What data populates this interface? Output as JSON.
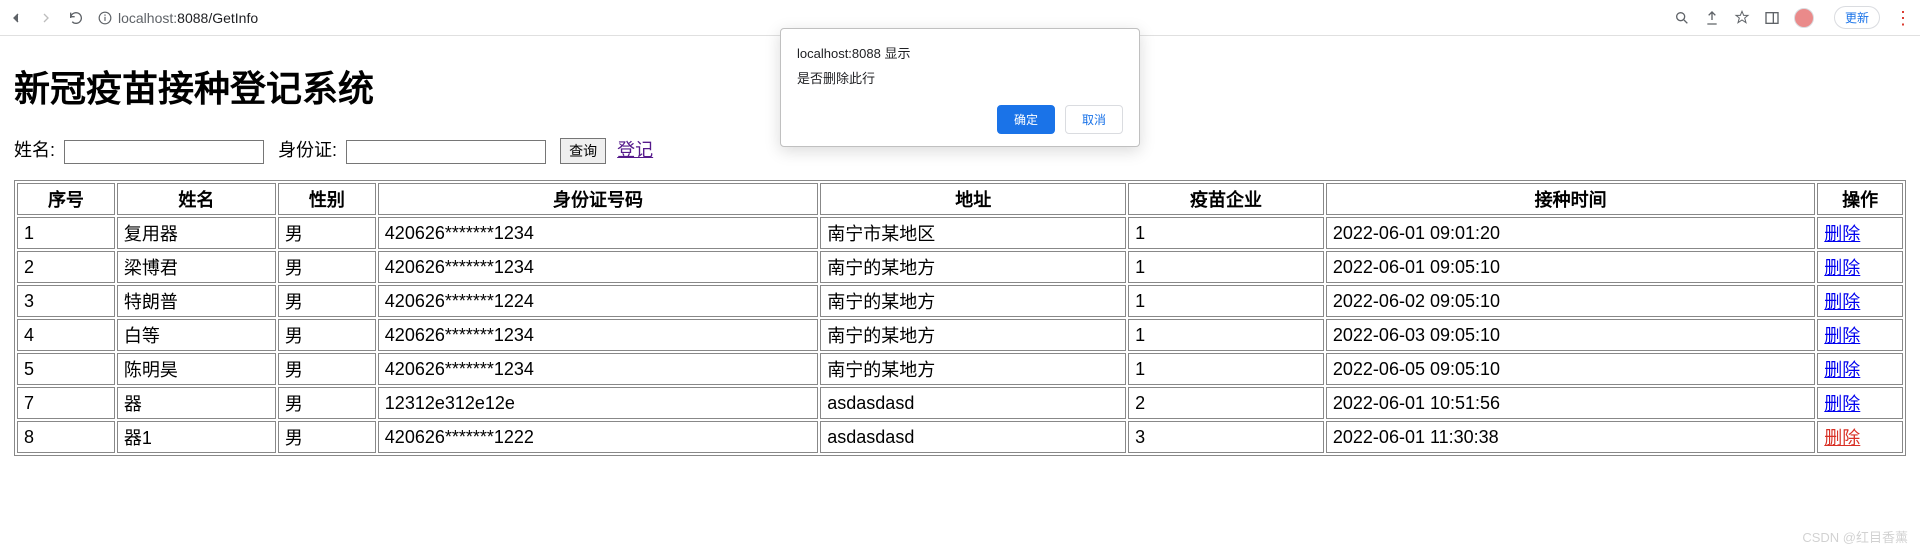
{
  "browser": {
    "url_host": "localhost:",
    "url_port": "8088",
    "url_path": "/GetInfo",
    "update_label": "更新"
  },
  "dialog": {
    "title": "localhost:8088 显示",
    "message": "是否删除此行",
    "ok": "确定",
    "cancel": "取消"
  },
  "page": {
    "title": "新冠疫苗接种登记系统",
    "search": {
      "name_label": "姓名:",
      "id_label": "身份证:",
      "query_btn": "查询",
      "register_link": "登记",
      "name_value": "",
      "id_value": ""
    },
    "columns": {
      "seq": "序号",
      "name": "姓名",
      "gender": "性别",
      "id": "身份证号码",
      "addr": "地址",
      "company": "疫苗企业",
      "time": "接种时间",
      "action": "操作"
    },
    "delete_label": "删除",
    "rows": [
      {
        "seq": "1",
        "name": "复用器",
        "gender": "男",
        "id": "420626*******1234",
        "addr": "南宁市某地区",
        "company": "1",
        "time": "2022-06-01 09:01:20",
        "active": false
      },
      {
        "seq": "2",
        "name": "梁博君",
        "gender": "男",
        "id": "420626*******1234",
        "addr": "南宁的某地方",
        "company": "1",
        "time": "2022-06-01 09:05:10",
        "active": false
      },
      {
        "seq": "3",
        "name": "特朗普",
        "gender": "男",
        "id": "420626*******1224",
        "addr": "南宁的某地方",
        "company": "1",
        "time": "2022-06-02 09:05:10",
        "active": false
      },
      {
        "seq": "4",
        "name": "白等",
        "gender": "男",
        "id": "420626*******1234",
        "addr": "南宁的某地方",
        "company": "1",
        "time": "2022-06-03 09:05:10",
        "active": false
      },
      {
        "seq": "5",
        "name": "陈明昊",
        "gender": "男",
        "id": "420626*******1234",
        "addr": "南宁的某地方",
        "company": "1",
        "time": "2022-06-05 09:05:10",
        "active": false
      },
      {
        "seq": "7",
        "name": "器",
        "gender": "男",
        "id": "12312e312e12e",
        "addr": "asdasdasd",
        "company": "2",
        "time": "2022-06-01 10:51:56",
        "active": false
      },
      {
        "seq": "8",
        "name": "器1",
        "gender": "男",
        "id": "420626*******1222",
        "addr": "asdasdasd",
        "company": "3",
        "time": "2022-06-01 11:30:38",
        "active": true
      }
    ]
  },
  "watermark": "CSDN @红目香薰"
}
